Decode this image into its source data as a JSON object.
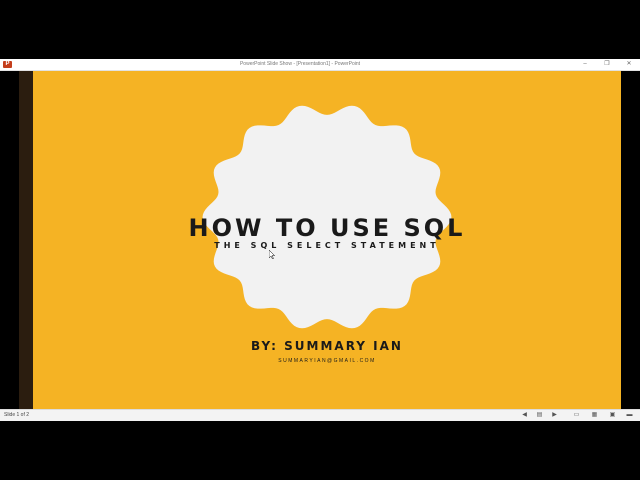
{
  "window": {
    "title": "PowerPoint Slide Show - [Presentation1] - PowerPoint",
    "app_icon_letter": "P",
    "controls": {
      "minimize": "–",
      "restore": "❐",
      "close": "✕"
    }
  },
  "slide": {
    "title": "HOW TO USE SQL",
    "subtitle": "THE SQL SELECT STATEMENT",
    "author": "BY: SUMMARY IAN",
    "email": "SUMMARYIAN@GMAIL.COM",
    "colors": {
      "background": "#f5b324",
      "badge": "#f2f2f2",
      "text": "#1a1a1a"
    }
  },
  "status": {
    "slide_counter": "Slide 1 of 2",
    "icons": [
      "prev-icon",
      "notes-icon",
      "next-icon",
      "normal-view-icon",
      "slide-sorter-icon",
      "reading-view-icon",
      "slideshow-icon",
      "zoom-icon"
    ]
  }
}
